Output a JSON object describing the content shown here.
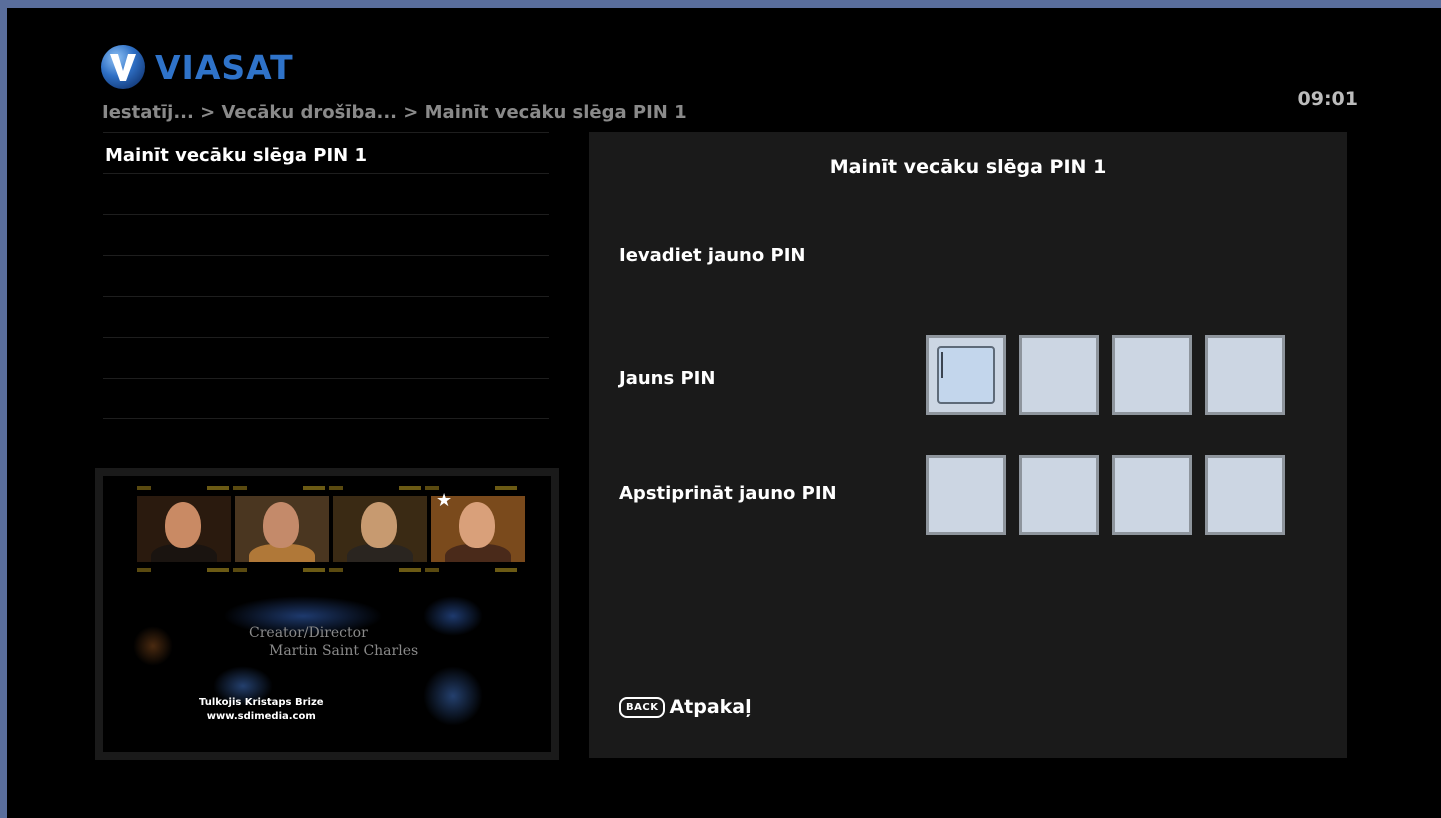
{
  "brand": {
    "name": "VIASAT",
    "logo_icon": "viasat-v-logo-icon",
    "colors": {
      "logo_blue": "#2f73c9",
      "frame": "#5a6e9c"
    }
  },
  "breadcrumb": "Iestatīj... > Vecāku drošība... > Mainīt vecāku slēga PIN 1",
  "clock": "09:01",
  "menu": {
    "items": [
      {
        "label": "Mainīt vecāku slēga PIN 1",
        "selected": true
      },
      {
        "label": ""
      },
      {
        "label": ""
      },
      {
        "label": ""
      },
      {
        "label": ""
      },
      {
        "label": ""
      },
      {
        "label": ""
      }
    ]
  },
  "preview": {
    "credit_role": "Creator/Director",
    "credit_name": "Martin Saint Charles",
    "translator_line": "Tulkojis Kristaps Brize",
    "translator_url": "www.sdimedia.com"
  },
  "panel": {
    "title": "Mainīt vecāku slēga PIN 1",
    "instruction": "Ievadiet jauno PIN",
    "new_pin_label": "Jauns PIN",
    "confirm_pin_label": "Apstiprināt jauno PIN",
    "new_pin_digits": [
      "",
      "",
      "",
      ""
    ],
    "confirm_pin_digits": [
      "",
      "",
      "",
      ""
    ],
    "active_field": "new_pin",
    "active_index": 0,
    "back_key": "BACK",
    "back_label": "Atpakaļ"
  }
}
